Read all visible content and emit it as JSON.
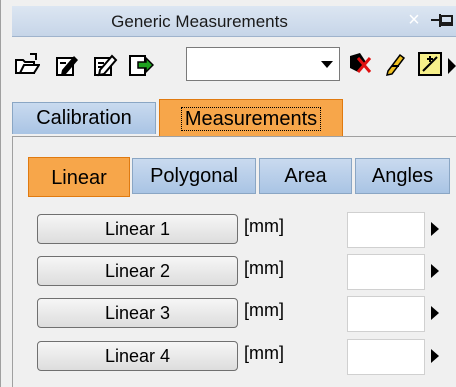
{
  "window": {
    "title": "Generic Measurements",
    "close_glyph": "×",
    "pin_icon": "pin-icon"
  },
  "toolbar": {
    "icons": [
      "open-folder-icon",
      "edit-document-icon",
      "edit-document-alt-icon",
      "export-icon"
    ],
    "combo_value": "",
    "right_icons": [
      "delete-measurement-icon",
      "pencil-tool-icon",
      "measure-tool-icon"
    ]
  },
  "tabs": {
    "outer": [
      {
        "label": "Calibration",
        "active": false
      },
      {
        "label": "Measurements",
        "active": true
      }
    ],
    "inner": [
      {
        "label": "Linear",
        "active": true
      },
      {
        "label": "Polygonal",
        "active": false
      },
      {
        "label": "Area",
        "active": false
      },
      {
        "label": "Angles",
        "active": false
      }
    ]
  },
  "measurements": [
    {
      "label": "Linear 1",
      "unit": "[mm]",
      "value": ""
    },
    {
      "label": "Linear 2",
      "unit": "[mm]",
      "value": ""
    },
    {
      "label": "Linear 3",
      "unit": "[mm]",
      "value": ""
    },
    {
      "label": "Linear 4",
      "unit": "[mm]",
      "value": ""
    }
  ],
  "colors": {
    "active_tab": "#f7a64a",
    "inactive_tab": "#b8cfe9",
    "titlebar": "#cfdcec"
  }
}
